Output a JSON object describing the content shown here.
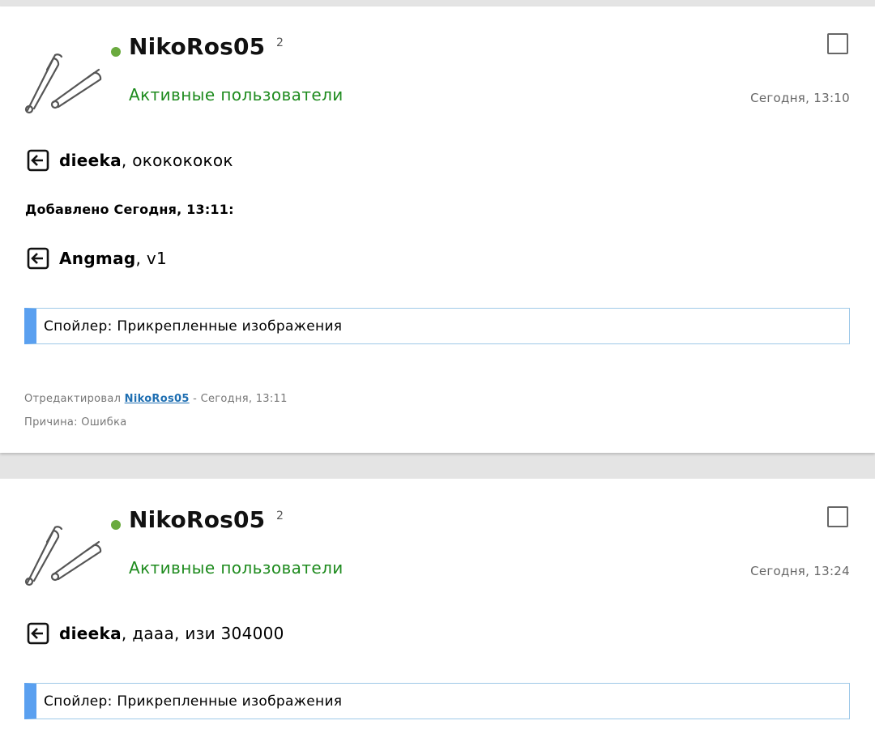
{
  "posts": [
    {
      "author": "NikoRos05",
      "reputation": "2",
      "group": "Активные пользователи",
      "time": "Сегодня, 13:10",
      "replies": [
        {
          "name": "dieeka",
          "text": ", ококококок"
        },
        {
          "name": "Angmag",
          "text": ", v1"
        }
      ],
      "added_note": "Добавлено Сегодня, 13:11:",
      "spoiler_label": "Спойлер: Прикрепленные изображения",
      "edit": {
        "prefix": "Отредактировал",
        "editor": "NikoRos05",
        "suffix": "- Сегодня, 13:11",
        "reason": "Причина: Ошибка"
      }
    },
    {
      "author": "NikoRos05",
      "reputation": "2",
      "group": "Активные пользователи",
      "time": "Сегодня, 13:24",
      "replies": [
        {
          "name": "dieeka",
          "text": ", дааа, изи 304000"
        }
      ],
      "spoiler_label": "Спойлер: Прикрепленные изображения"
    }
  ],
  "colors": {
    "online": "#6aaa3e",
    "group": "#1e8b1e",
    "spoiler_accent": "#5aa0f0",
    "link": "#1f6fb2"
  },
  "icons": {
    "avatar": "safety-pin-icon",
    "reply": "quote-reply-icon",
    "select": "checkbox-icon"
  }
}
